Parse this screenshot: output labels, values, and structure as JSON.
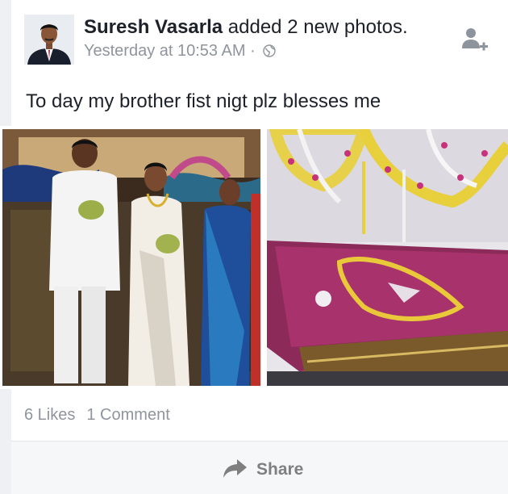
{
  "post": {
    "author": "Suresh Vasarla",
    "action": " added 2 new photos.",
    "time": "Yesterday at 10:53 AM",
    "separator": " · ",
    "caption": "To day my brother  fist nigt plz blesses me"
  },
  "icons": {
    "privacy": "globe-icon",
    "add_friend": "add-friend-icon",
    "share": "share-arrow-icon"
  },
  "stats": {
    "likes": "6 Likes",
    "comments": "1 Comment"
  },
  "actions": {
    "share_label": "Share"
  },
  "colors": {
    "text": "#1d2129",
    "meta": "#90949c",
    "icon_gray": "#8d949e"
  }
}
